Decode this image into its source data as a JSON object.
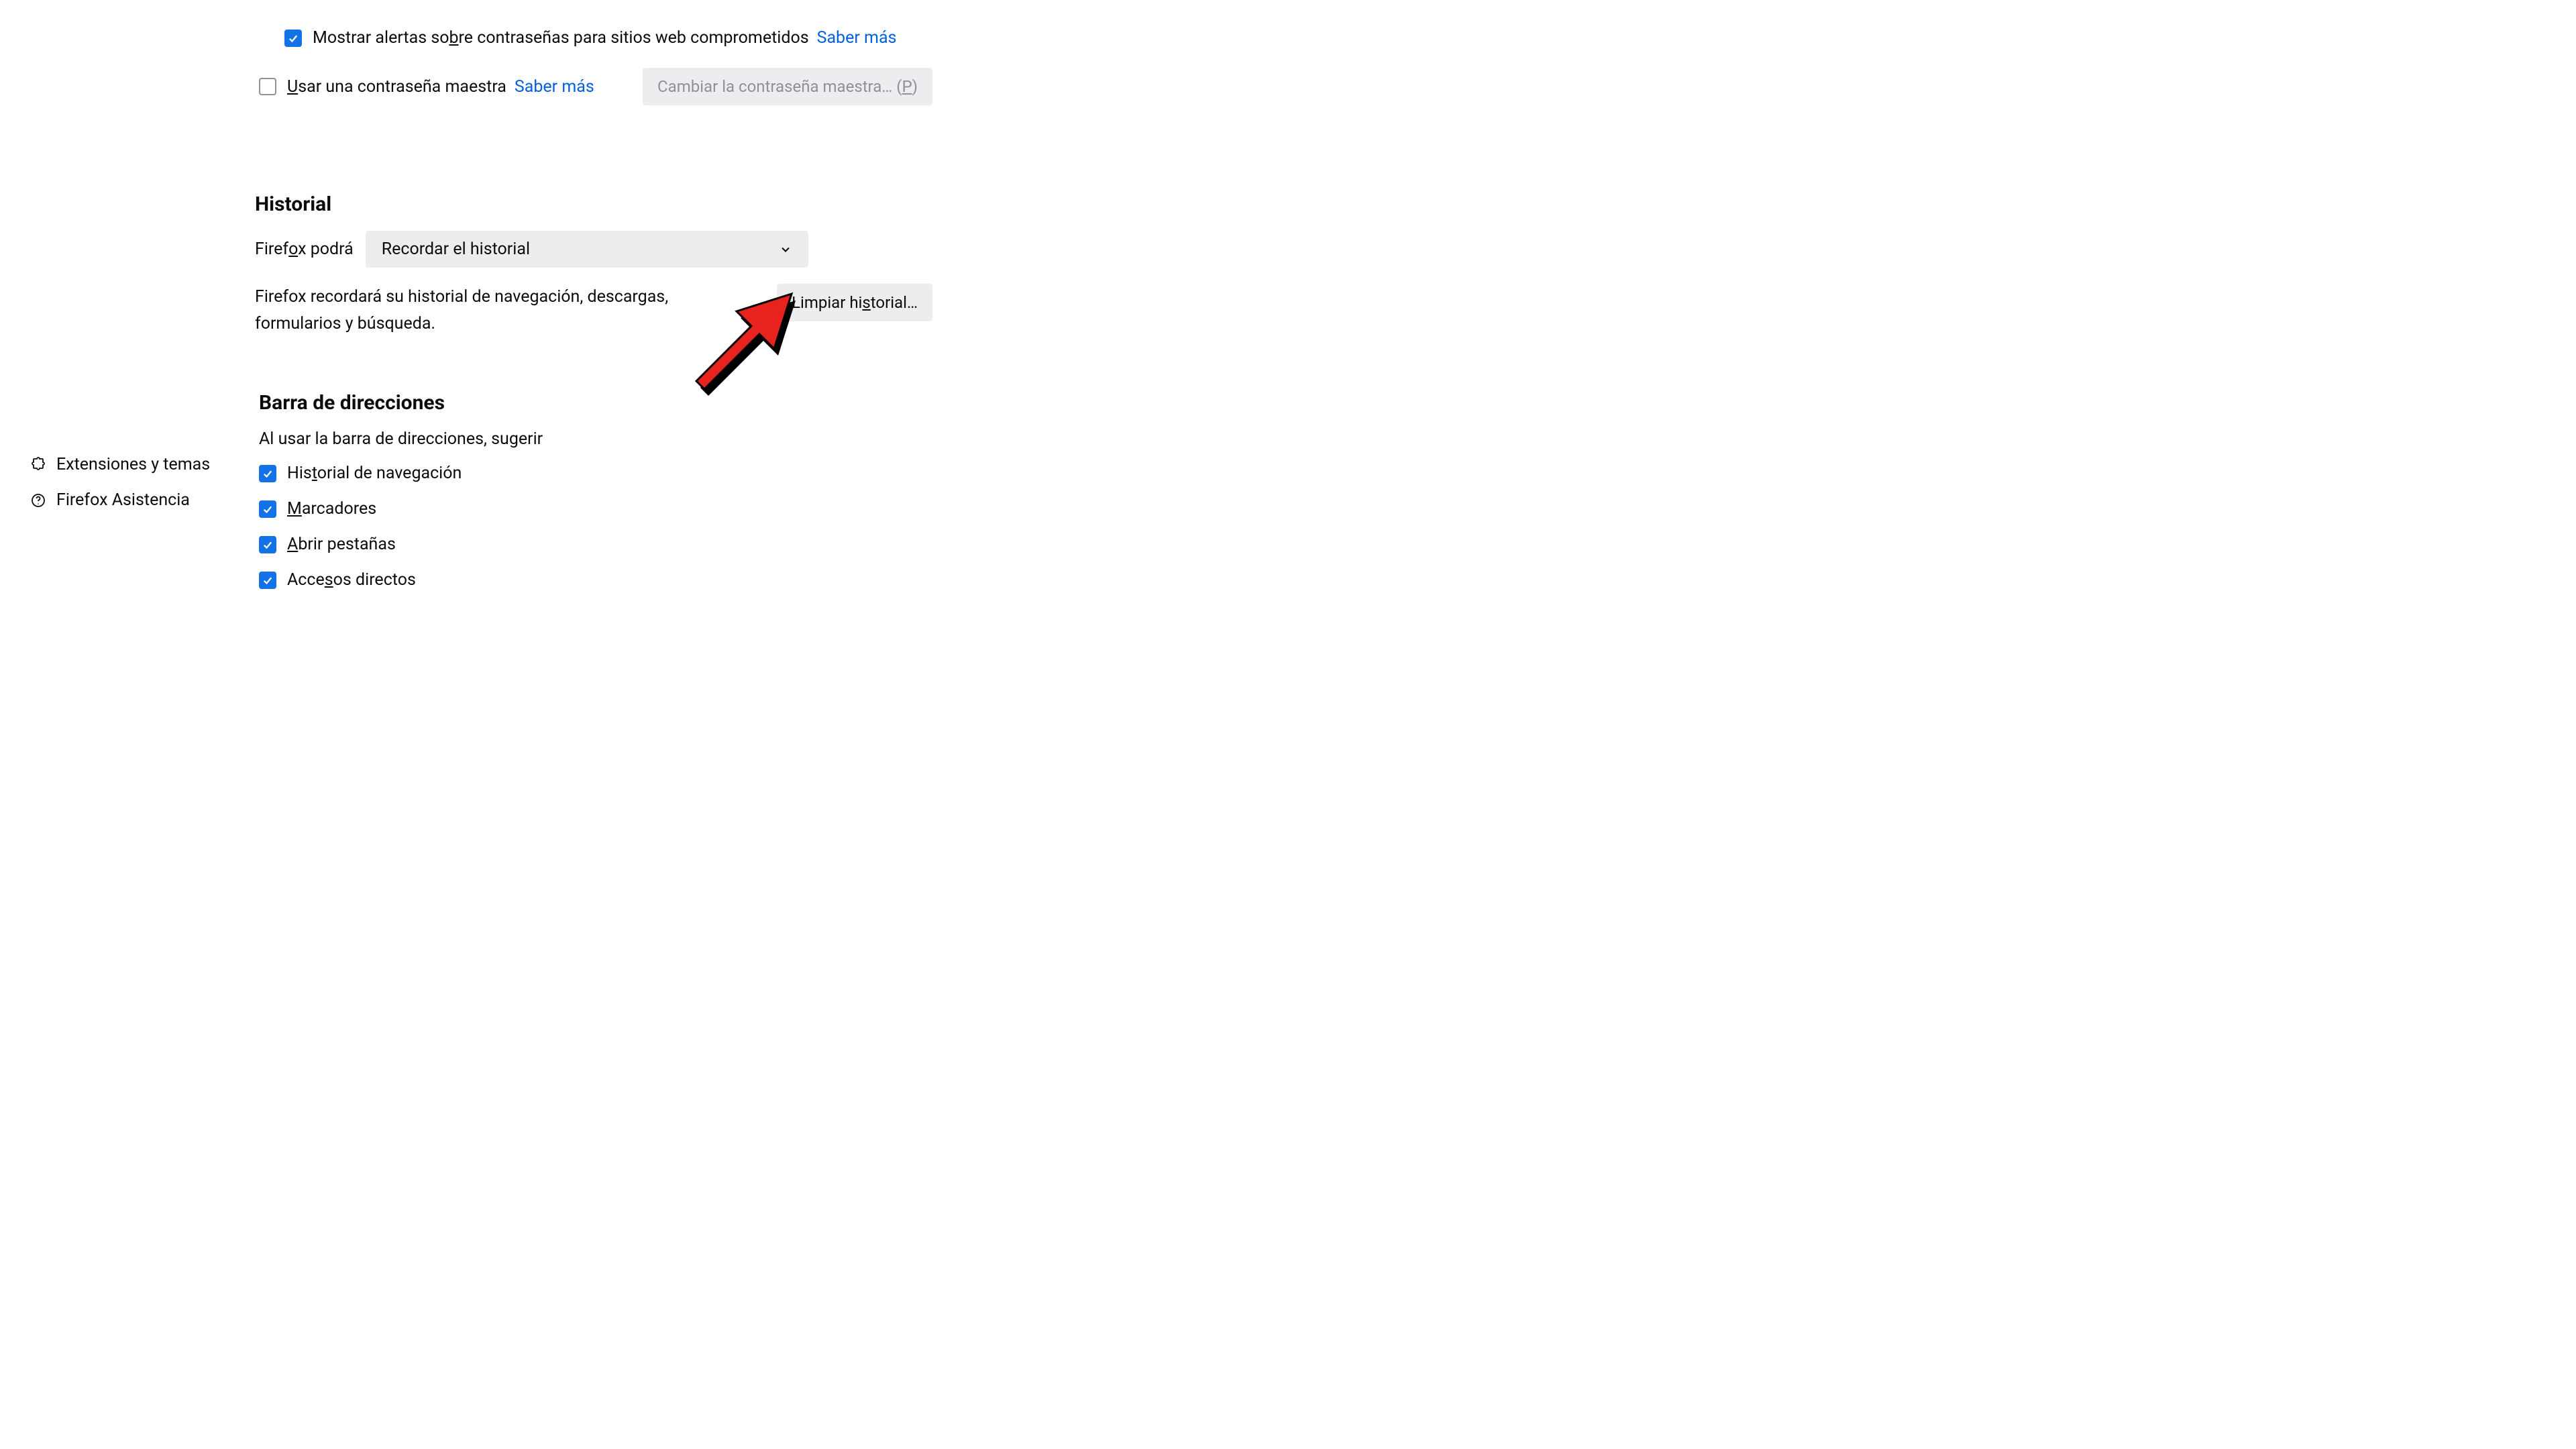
{
  "passwords": {
    "show_alerts_label_pre": "Mostrar alertas so",
    "show_alerts_underline": "b",
    "show_alerts_label_post": "re contraseñas para sitios web comprometidos",
    "learn_more": "Saber más",
    "master_password_pre": "",
    "master_password_underline": "U",
    "master_password_post": "sar una contraseña maestra",
    "change_master_button_pre": "Cambiar la contraseña maestra… (",
    "change_master_underline": "P",
    "change_master_button_post": ")"
  },
  "history": {
    "heading": "Historial",
    "firefox_will_pre": "Firef",
    "firefox_will_underline": "o",
    "firefox_will_post": "x podrá",
    "mode_selected": "Recordar el historial",
    "description": "Firefox recordará su historial de navegación, descargas, formularios y búsqueda.",
    "clear_button_pre": "Limpiar hi",
    "clear_button_underline": "s",
    "clear_button_post": "torial…"
  },
  "address_bar": {
    "heading": "Barra de direcciones",
    "intro": "Al usar la barra de direcciones, sugerir",
    "items": [
      {
        "pre": "His",
        "u": "t",
        "post": "orial de navegación"
      },
      {
        "pre": "",
        "u": "M",
        "post": "arcadores"
      },
      {
        "pre": "",
        "u": "A",
        "post": "brir pestañas"
      },
      {
        "pre": "Acce",
        "u": "s",
        "post": "os directos"
      }
    ]
  },
  "sidebar": {
    "extensions": "Extensiones y temas",
    "support": "Firefox Asistencia"
  }
}
